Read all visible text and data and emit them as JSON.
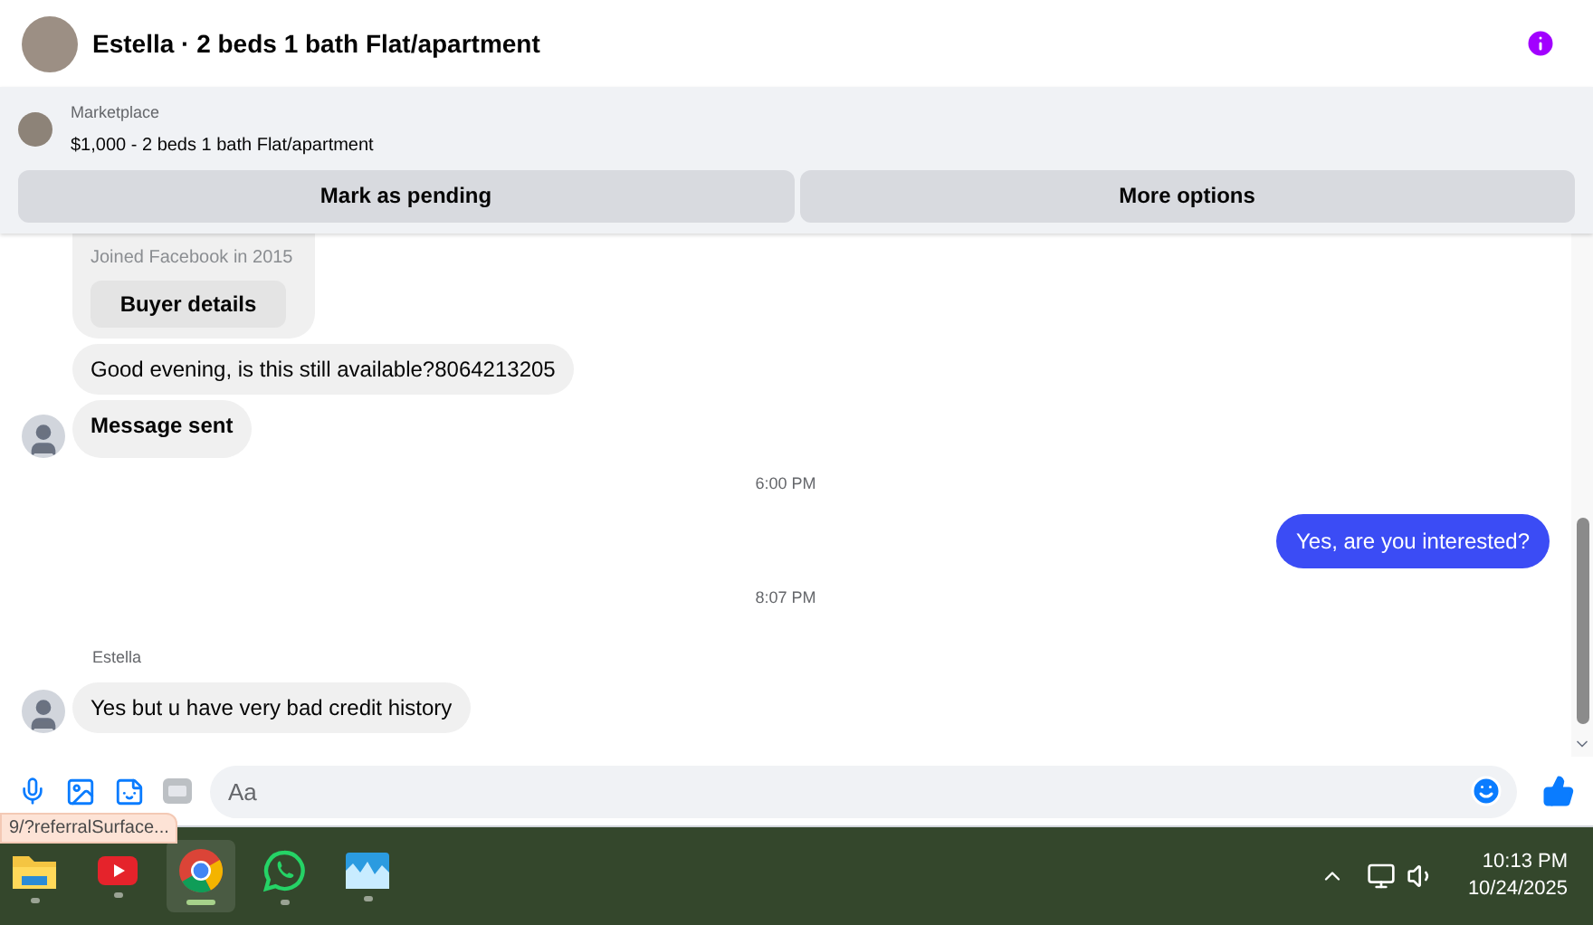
{
  "header": {
    "title": "Estella · 2 beds 1 bath Flat/apartment"
  },
  "listing": {
    "source": "Marketplace",
    "title": "$1,000 - 2 beds 1 bath Flat/apartment"
  },
  "actions": [
    "Mark as pending",
    "More options"
  ],
  "messages": [
    {
      "kind": "card",
      "subtitle": "Joined Facebook in 2015",
      "button": "Buyer details"
    },
    {
      "kind": "incoming",
      "text": "Good evening, is this still available?8064213205",
      "avatar": false,
      "bold": false
    },
    {
      "kind": "incoming",
      "text": "Message sent",
      "avatar": true,
      "bold": true
    },
    {
      "kind": "timestamp",
      "text": "6:00 PM"
    },
    {
      "kind": "outgoing",
      "text": "Yes, are you interested?"
    },
    {
      "kind": "timestamp",
      "text": "8:07 PM"
    },
    {
      "kind": "sender",
      "text": "Estella"
    },
    {
      "kind": "incoming",
      "text": "Yes but u have very bad credit history",
      "avatar": true,
      "bold": false
    }
  ],
  "composer": {
    "placeholder": "Aa"
  },
  "link_preview": "9/?referralSurface...",
  "taskbar": {
    "apps": [
      {
        "kind": "folder",
        "selected": false
      },
      {
        "kind": "youtube",
        "selected": false
      },
      {
        "kind": "chrome",
        "selected": true
      },
      {
        "kind": "whatsapp",
        "selected": false
      },
      {
        "kind": "photos",
        "selected": false
      }
    ],
    "time": "10:13 PM",
    "date": "10/24/2025"
  }
}
